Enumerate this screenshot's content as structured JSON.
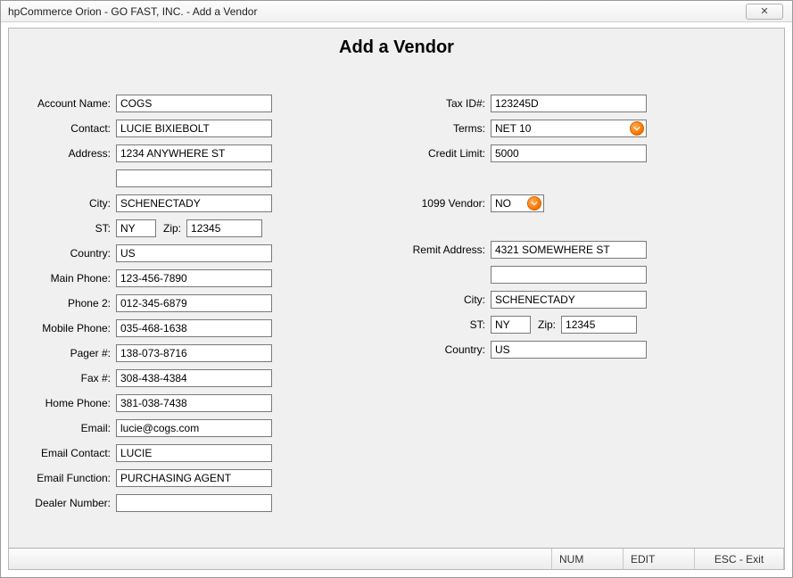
{
  "window": {
    "title": "hpCommerce Orion - GO FAST, INC. - Add a Vendor",
    "close_glyph": "✕"
  },
  "page": {
    "title": "Add a Vendor"
  },
  "labels": {
    "account_name": "Account Name:",
    "contact": "Contact:",
    "address": "Address:",
    "city": "City:",
    "st": "ST:",
    "zip": "Zip:",
    "country": "Country:",
    "main_phone": "Main Phone:",
    "phone2": "Phone 2:",
    "mobile_phone": "Mobile Phone:",
    "pager": "Pager #:",
    "fax": "Fax #:",
    "home_phone": "Home Phone:",
    "email": "Email:",
    "email_contact": "Email Contact:",
    "email_function": "Email Function:",
    "dealer_number": "Dealer Number:",
    "tax_id": "Tax ID#:",
    "terms": "Terms:",
    "credit_limit": "Credit Limit:",
    "v1099": "1099 Vendor:",
    "remit_address": "Remit Address:",
    "remit_city": "City:",
    "remit_st": "ST:",
    "remit_zip": "Zip:",
    "remit_country": "Country:"
  },
  "values": {
    "account_name": "COGS",
    "contact": "LUCIE BIXIEBOLT",
    "address1": "1234 ANYWHERE ST",
    "address2": "",
    "city": "SCHENECTADY",
    "st": "NY",
    "zip": "12345",
    "country": "US",
    "main_phone": "123-456-7890",
    "phone2": "012-345-6879",
    "mobile_phone": "035-468-1638",
    "pager": "138-073-8716",
    "fax": "308-438-4384",
    "home_phone": "381-038-7438",
    "email": "lucie@cogs.com",
    "email_contact": "LUCIE",
    "email_function": "PURCHASING AGENT",
    "dealer_number": "",
    "tax_id": "123245D",
    "terms": "NET 10",
    "credit_limit": "5000",
    "v1099": "NO",
    "remit_address1": "4321 SOMEWHERE ST",
    "remit_address2": "",
    "remit_city": "SCHENECTADY",
    "remit_st": "NY",
    "remit_zip": "12345",
    "remit_country": "US"
  },
  "status": {
    "num": "NUM",
    "edit": "EDIT",
    "esc": "ESC - Exit"
  }
}
